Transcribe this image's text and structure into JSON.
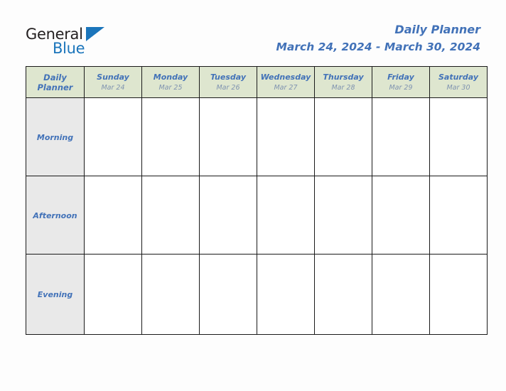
{
  "brand": {
    "name_part_1": "General",
    "name_part_2": "Blue",
    "triangle_color": "#1b75bb",
    "text_color": "#231f20"
  },
  "header": {
    "title": "Daily Planner",
    "date_range": "March 24, 2024 - March 30, 2024",
    "title_color": "#4272b8"
  },
  "table": {
    "corner_label_line1": "Daily",
    "corner_label_line2": "Planner",
    "header_background": "#dee6cf",
    "row_label_background": "#e9e9e9",
    "cell_background": "#ffffff",
    "border_color": "#1a1a1a",
    "columns": [
      {
        "day": "Sunday",
        "date": "Mar 24"
      },
      {
        "day": "Monday",
        "date": "Mar 25"
      },
      {
        "day": "Tuesday",
        "date": "Mar 26"
      },
      {
        "day": "Wednesday",
        "date": "Mar 27"
      },
      {
        "day": "Thursday",
        "date": "Mar 28"
      },
      {
        "day": "Friday",
        "date": "Mar 29"
      },
      {
        "day": "Saturday",
        "date": "Mar 30"
      }
    ],
    "rows": [
      {
        "label": "Morning",
        "entries": [
          "",
          "",
          "",
          "",
          "",
          "",
          ""
        ]
      },
      {
        "label": "Afternoon",
        "entries": [
          "",
          "",
          "",
          "",
          "",
          "",
          ""
        ]
      },
      {
        "label": "Evening",
        "entries": [
          "",
          "",
          "",
          "",
          "",
          "",
          ""
        ]
      }
    ]
  }
}
